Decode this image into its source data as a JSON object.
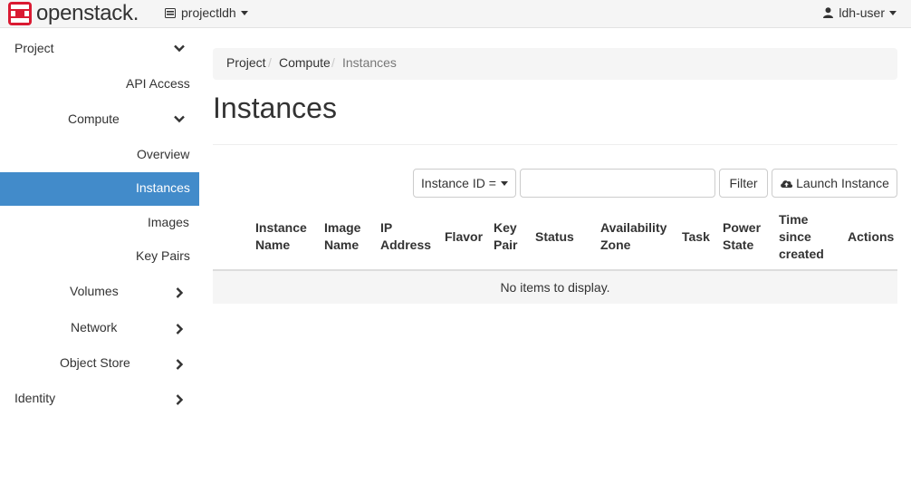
{
  "header": {
    "brand": "openstack.",
    "brand_logo_icon": "openstack-logo-icon",
    "project": "projectldh",
    "user": "ldh-user"
  },
  "sidebar": {
    "items": [
      {
        "label": "Project",
        "icon": "chevron-down-icon"
      },
      {
        "label": "API Access"
      },
      {
        "label": "Compute",
        "icon": "chevron-down-icon"
      },
      {
        "label": "Overview"
      },
      {
        "label": "Instances",
        "active": true
      },
      {
        "label": "Images"
      },
      {
        "label": "Key Pairs"
      },
      {
        "label": "Volumes",
        "icon": "chevron-right-icon"
      },
      {
        "label": "Network",
        "icon": "chevron-right-icon"
      },
      {
        "label": "Object Store",
        "icon": "chevron-right-icon"
      },
      {
        "label": "Identity",
        "icon": "chevron-right-icon"
      }
    ]
  },
  "breadcrumb": [
    "Project",
    "Compute",
    "Instances"
  ],
  "page_title": "Instances",
  "toolbar": {
    "filter_field": "Instance ID =",
    "filter_value": "",
    "filter_button": "Filter",
    "launch_button": "Launch Instance"
  },
  "table": {
    "columns": [
      [
        "Instance",
        "Name"
      ],
      [
        "Image",
        "Name"
      ],
      [
        "IP",
        "Address"
      ],
      [
        "Flavor"
      ],
      [
        "Key",
        "Pair"
      ],
      [
        "Status"
      ],
      [
        "Availability",
        "Zone"
      ],
      [
        "Task"
      ],
      [
        "Power",
        "State"
      ],
      [
        "Time",
        "since",
        "created"
      ],
      [
        "Actions"
      ]
    ],
    "empty_message": "No items to display."
  },
  "colors": {
    "active_nav": "#428bca",
    "brand_red": "#da1a32"
  }
}
